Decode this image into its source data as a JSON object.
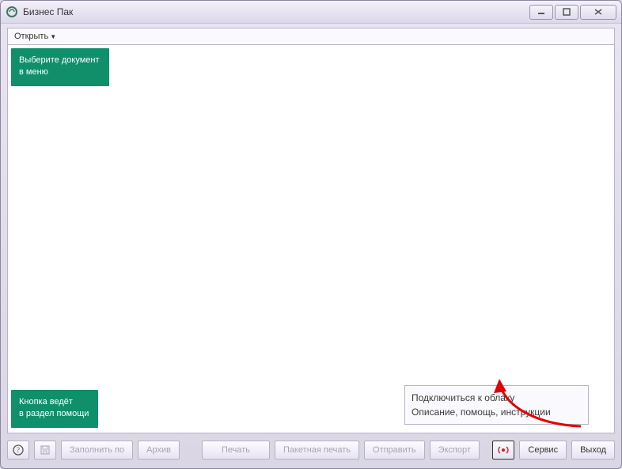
{
  "window": {
    "title": "Бизнес Пак"
  },
  "menubar": {
    "open": "Открыть"
  },
  "tips": {
    "top_line1": "Выберите документ",
    "top_line2": "в меню",
    "bottom_line1": "Кнопка ведёт",
    "bottom_line2": "в раздел помощи"
  },
  "popup": {
    "row1": "Подключиться к облаку",
    "row2": "Описание, помощь, инструкции"
  },
  "toolbar": {
    "fill": "Заполнить по",
    "archive": "Архив",
    "print": "Печать",
    "batch": "Пакетная печать",
    "send": "Отправить",
    "export": "Экспорт",
    "service": "Сервис",
    "exit": "Выход"
  }
}
